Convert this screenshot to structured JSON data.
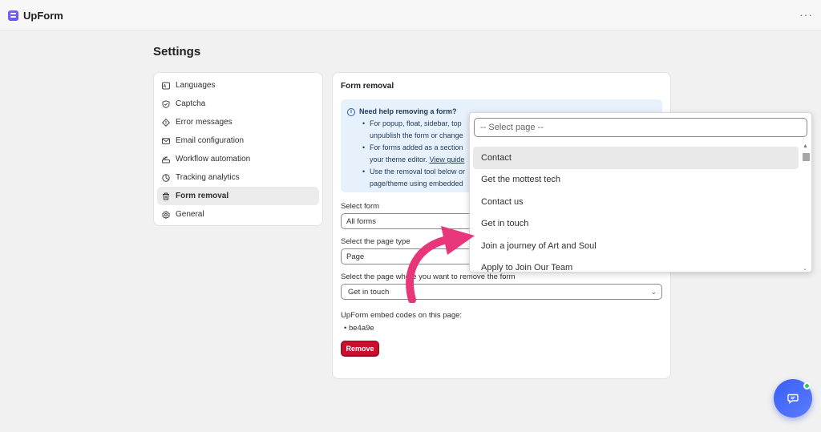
{
  "app": {
    "name": "UpForm",
    "more": "···"
  },
  "page": {
    "title": "Settings"
  },
  "sidebar": {
    "items": [
      {
        "label": "Languages",
        "icon": "language-icon"
      },
      {
        "label": "Captcha",
        "icon": "shield-icon"
      },
      {
        "label": "Error messages",
        "icon": "warning-diamond-icon"
      },
      {
        "label": "Email configuration",
        "icon": "envelope-icon"
      },
      {
        "label": "Workflow automation",
        "icon": "workflow-icon"
      },
      {
        "label": "Tracking analytics",
        "icon": "analytics-icon"
      },
      {
        "label": "Form removal",
        "icon": "trash-icon",
        "active": true
      },
      {
        "label": "General",
        "icon": "gear-icon"
      }
    ]
  },
  "main": {
    "section_title": "Form removal",
    "banner": {
      "heading": "Need help removing a form?",
      "bullet1_line1": "For popup, float, sidebar, top",
      "bullet1_line2": "unpublish the form or change",
      "bullet2_line1": "For forms added as a section",
      "bullet2_line2": "your theme editor.",
      "bullet2_link": "View guide",
      "bullet3_line1": "Use the removal tool below or",
      "bullet3_line2": "page/theme using embedded"
    },
    "select_form": {
      "label": "Select form",
      "value": "All forms"
    },
    "page_type": {
      "label": "Select the page type",
      "value": "Page"
    },
    "target_page": {
      "label": "Select the page where you want to remove the form",
      "value": "Get in touch"
    },
    "embed": {
      "label": "UpForm embed codes on this page:",
      "code": "be4a9e"
    },
    "remove_label": "Remove"
  },
  "dropdown": {
    "placeholder": "-- Select page --",
    "options": [
      "Contact",
      "Get the mottest tech",
      "Contact us",
      "Get in touch",
      "Join a journey of Art and Soul",
      "Apply to Join Our Team"
    ],
    "selected_index": 0
  },
  "colors": {
    "accent": "#c8102e",
    "chat": "#4a6cf7",
    "arrow": "#e8367a",
    "banner": "#e7f1fb"
  }
}
